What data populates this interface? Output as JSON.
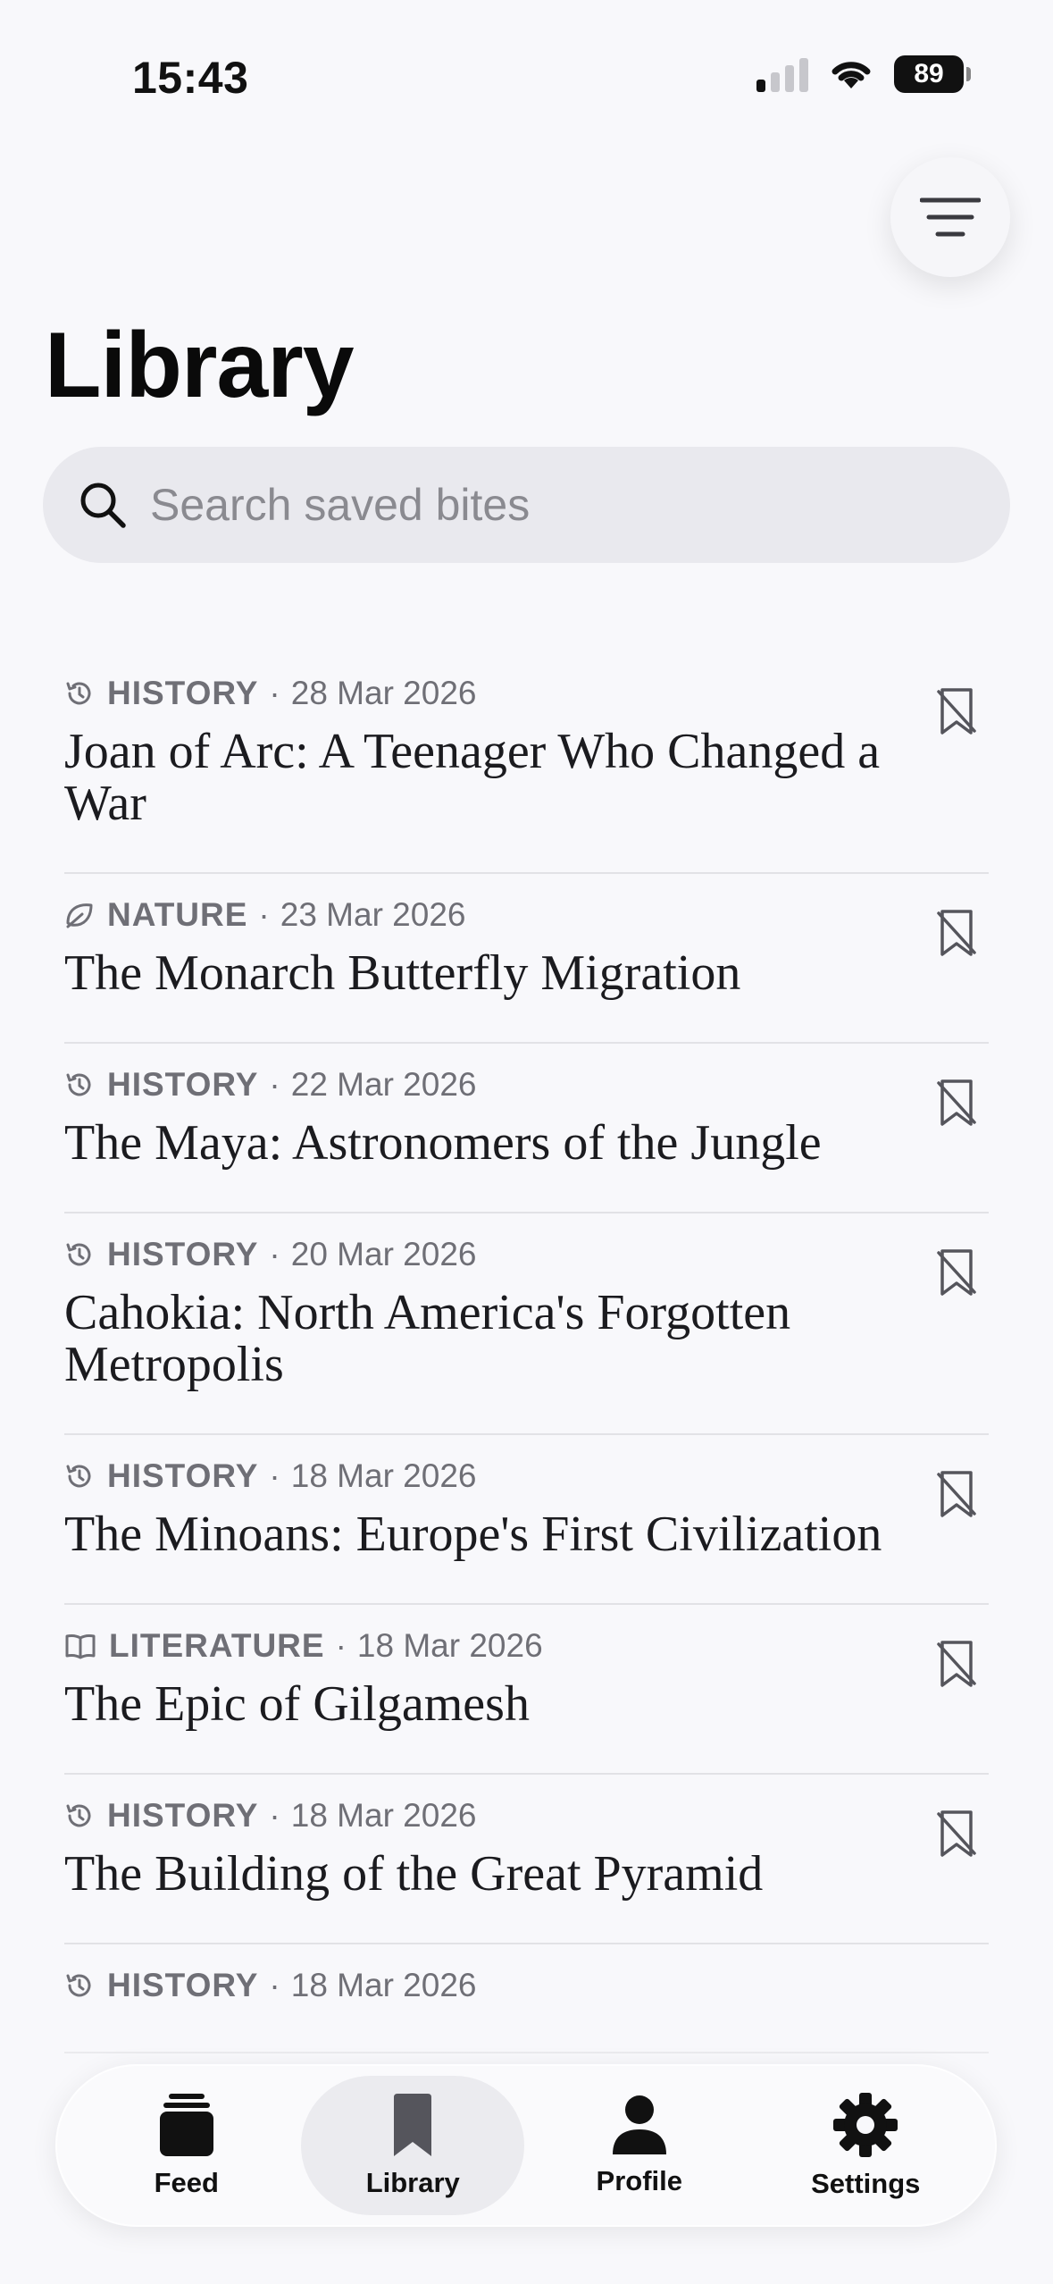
{
  "status": {
    "time": "15:43",
    "battery": "89"
  },
  "header": {
    "title": "Library"
  },
  "search": {
    "placeholder": "Search saved bites",
    "icon": "search-icon"
  },
  "items": [
    {
      "category": "HISTORY",
      "icon": "history-icon",
      "date": "28 Mar 2026",
      "title": "Joan of Arc: A Teenager Who Changed a War"
    },
    {
      "category": "NATURE",
      "icon": "leaf-icon",
      "date": "23 Mar 2026",
      "title": "The Monarch Butterfly Migration"
    },
    {
      "category": "HISTORY",
      "icon": "history-icon",
      "date": "22 Mar 2026",
      "title": "The Maya: Astronomers of the Jungle"
    },
    {
      "category": "HISTORY",
      "icon": "history-icon",
      "date": "20 Mar 2026",
      "title": "Cahokia: North America's Forgotten Metropolis"
    },
    {
      "category": "HISTORY",
      "icon": "history-icon",
      "date": "18 Mar 2026",
      "title": "The Minoans: Europe's First Civilization"
    },
    {
      "category": "LITERATURE",
      "icon": "book-icon",
      "date": "18 Mar 2026",
      "title": "The Epic of Gilgamesh"
    },
    {
      "category": "HISTORY",
      "icon": "history-icon",
      "date": "18 Mar 2026",
      "title": "The Building of the Great Pyramid"
    },
    {
      "category": "HISTORY",
      "icon": "history-icon",
      "date": "18 Mar 2026",
      "title": ""
    }
  ],
  "tabs": [
    {
      "label": "Feed",
      "icon": "feed-icon"
    },
    {
      "label": "Library",
      "icon": "bookmark-icon"
    },
    {
      "label": "Profile",
      "icon": "person-icon"
    },
    {
      "label": "Settings",
      "icon": "gear-icon"
    }
  ]
}
